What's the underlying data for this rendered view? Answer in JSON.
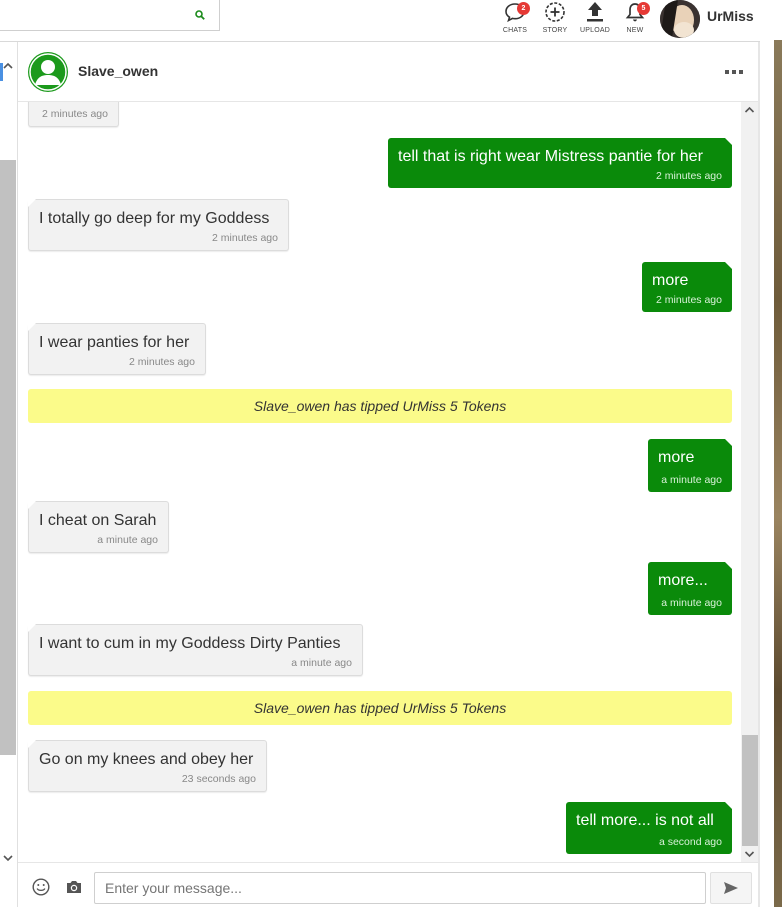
{
  "topbar": {
    "search_icon": "search-icon",
    "nav": [
      {
        "label": "CHATS",
        "icon": "chat-bubble-icon",
        "badge": "2"
      },
      {
        "label": "STORY",
        "icon": "add-story-icon"
      },
      {
        "label": "UPLOAD",
        "icon": "upload-icon"
      },
      {
        "label": "NEW",
        "icon": "bell-icon",
        "badge": "5"
      }
    ],
    "user_name": "UrMiss"
  },
  "chat": {
    "contact_name": "Slave_owen",
    "more_icon": "more-dots-icon"
  },
  "messages": [
    {
      "side": "in",
      "text": "",
      "time": "2 minutes ago"
    },
    {
      "side": "out",
      "text": "tell that is right wear Mistress pantie for her",
      "time": "2 minutes ago"
    },
    {
      "side": "in",
      "text": "I totally go deep for my Goddess",
      "time": "2 minutes ago"
    },
    {
      "side": "out",
      "text": "more",
      "time": "2 minutes ago"
    },
    {
      "side": "in",
      "text": "I wear panties for her",
      "time": "2 minutes ago"
    },
    {
      "side": "tip",
      "text": "Slave_owen has tipped UrMiss 5 Tokens"
    },
    {
      "side": "out",
      "text": "more",
      "time": "a minute ago"
    },
    {
      "side": "in",
      "text": "I cheat on Sarah",
      "time": "a minute ago"
    },
    {
      "side": "out",
      "text": "more...",
      "time": "a minute ago"
    },
    {
      "side": "in",
      "text": "I want to cum in my Goddess Dirty Panties",
      "time": "a minute ago"
    },
    {
      "side": "tip",
      "text": "Slave_owen has tipped UrMiss 5 Tokens"
    },
    {
      "side": "in",
      "text": "Go on my knees and obey her",
      "time": "23 seconds ago"
    },
    {
      "side": "out",
      "text": "tell more... is not all",
      "time": "a second ago"
    }
  ],
  "composer": {
    "placeholder": "Enter your message...",
    "value": ""
  },
  "colors": {
    "outgoing_bubble": "#0a8a0a",
    "incoming_bubble": "#f2f2f2",
    "tip_banner": "#fbfb8a",
    "badge": "#e53935",
    "avatar_green": "#1c9a1c"
  }
}
